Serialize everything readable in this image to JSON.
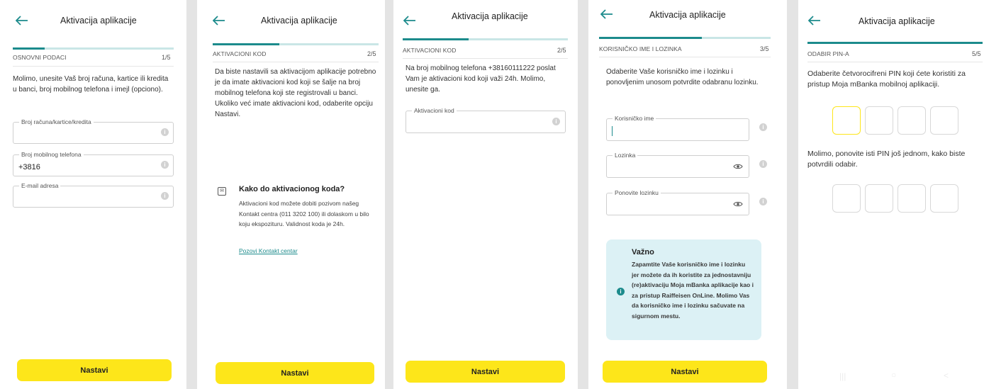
{
  "colors": {
    "accent": "#1c8b8c",
    "button": "#fde61a",
    "note_bg": "#dcf1f5"
  },
  "app_title": "Aktivacija aplikacije",
  "button_label": "Nastavi",
  "s1": {
    "step_label": "OSNOVNI PODACI",
    "step_num": "1/5",
    "progress": 0.2,
    "intro": "Molimo, unesite Vaš broj računa, kartice ili kredita u banci, broj mobilnog telefona i imejl (opciono).",
    "fields": [
      {
        "label": "Broj računa/kartice/kredita",
        "value": ""
      },
      {
        "label": "Broj mobilnog telefona",
        "value": "+3816"
      },
      {
        "label": "E-mail adresa",
        "value": ""
      }
    ]
  },
  "s2": {
    "step_label": "AKTIVACIONI KOD",
    "step_num": "2/5",
    "progress": 0.4,
    "intro": "Da biste nastavili sa aktivacijom aplikacije potrebno je da imate aktivacioni kod koji se šalje na broj mobilnog telefona koji ste registrovali u banci. Ukoliko već imate aktivacioni kod, odaberite opciju Nastavi.",
    "help_title": "Kako do aktivacionog koda?",
    "help_text": "Aktivacioni kod možete dobiti pozivom našeg Kontakt centra (011 3202 100) ili dolaskom u bilo koju ekspozituru. Validnost koda je 24h.",
    "help_link": "Pozovi Kontakt centar"
  },
  "s3": {
    "step_label": "AKTIVACIONI KOD",
    "step_num": "2/5",
    "progress": 0.4,
    "intro": "Na broj mobilnog telefona +38160111222 poslat Vam je aktivacioni kod koji važi 24h. Molimo, unesite ga.",
    "field_label": "Aktivacioni kod"
  },
  "s4": {
    "step_label": "KORISNIČKO IME I LOZINKA",
    "step_num": "3/5",
    "progress": 0.6,
    "intro": "Odaberite Vaše korisničko ime i lozinku i ponovljenim unosom potvrdite odabranu lozinku.",
    "fields": [
      {
        "label": "Korisničko ime"
      },
      {
        "label": "Lozinka"
      },
      {
        "label": "Ponovite lozinku"
      }
    ],
    "note_title": "Važno",
    "note_text": "Zapamtite Vaše korisničko ime i lozinku jer možete da ih koristite za jednostavniju (re)aktivaciju Moja mBanka aplikacije kao i za pristup Raiffeisen OnLine. Molimo Vas da korisničko ime i lozinku sačuvate na sigurnom mestu."
  },
  "s5": {
    "step_label": "ODABIR PIN-A",
    "step_num": "5/5",
    "progress": 1.0,
    "intro": "Odaberite četvorocifreni PIN koji ćete koristiti za pristup Moja mBanka mobilnoj aplikaciji.",
    "confirm_text": "Molimo, ponovite isti PIN još jednom, kako biste potvrdili odabir."
  },
  "icons": {
    "back": "arrow-left-icon",
    "info": "info-icon",
    "eye": "eye-icon",
    "help": "sms-icon",
    "navbar": [
      "menu-icon",
      "home-icon",
      "back-nav-icon"
    ]
  }
}
